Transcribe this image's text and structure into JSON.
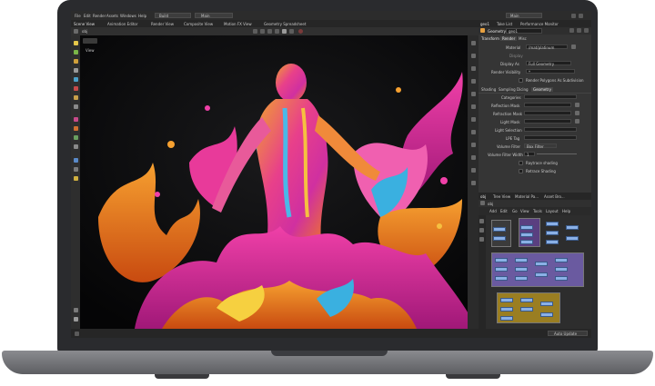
{
  "menu": {
    "items": [
      "File",
      "Edit",
      "Render",
      "Assets",
      "Windows",
      "Help"
    ],
    "desktop": "Build",
    "main_label": "Main",
    "right_label": "Main"
  },
  "tabs": [
    "Scene View",
    "Animation Editor",
    "Render View",
    "Composite View",
    "Motion FX View",
    "Geometry Spreadsheet"
  ],
  "viewport": {
    "path": "obj",
    "label": "View"
  },
  "right_tabs": [
    "geo1",
    "Take List",
    "Performance Monitor"
  ],
  "params": {
    "node_type": "Geometry",
    "node_name": "geo1",
    "tabs": [
      "Transform",
      "Render",
      "Misc"
    ],
    "material_label": "Material",
    "material_value": "/mat/platinum",
    "display_label": "Display",
    "display_as_label": "Display As",
    "display_as_value": "Full Geometry",
    "render_visibility_label": "Render Visibility",
    "render_visibility_value": "*",
    "render_polygons_label": "Render Polygons As Subdivision",
    "sub_tabs": [
      "Shading",
      "Sampling",
      "Dicing",
      "Geometry"
    ],
    "categories_label": "Categories",
    "reflection_mask_label": "Reflection Mask",
    "refraction_mask_label": "Refraction Mask",
    "light_mask_label": "Light Mask",
    "light_selection_label": "Light Selection",
    "lpe_tag_label": "LPE Tag",
    "volume_filter_label": "Volume Filter",
    "volume_filter_value": "Box Filter",
    "volume_filter_width_label": "Volume Filter Width",
    "volume_filter_width_value": "1",
    "raytrace_shading_label": "Raytrace shading",
    "retrace_shading_label": "Retrace Shading"
  },
  "network": {
    "tabs": [
      "obj",
      "Tree View",
      "Material Pa...",
      "Asset Bro..."
    ],
    "path": "obj",
    "menu": [
      "Add",
      "Edit",
      "Go",
      "View",
      "Tools",
      "Layout",
      "Help"
    ]
  },
  "status": {
    "auto_update": "Auto Update"
  },
  "colors": {
    "accent_orange": "#e8762a",
    "accent_magenta": "#e0288f",
    "net_purple": "#6a4f9a",
    "net_yellow": "#b3962b",
    "node_blue": "#8ab0e6"
  }
}
